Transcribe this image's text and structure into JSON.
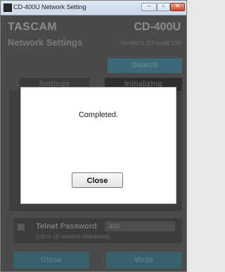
{
  "window": {
    "title": "CD-400U Network Setting",
    "controls": {
      "minimize": "–",
      "maximize": "▫",
      "close": "✕"
    }
  },
  "header": {
    "brand": "TASCAM",
    "model": "CD-400U",
    "section_title": "Network Settings",
    "version": "version:1.0.0 build:130"
  },
  "toolbar": {
    "search_label": "Search"
  },
  "tabs": [
    {
      "label": "Settings"
    },
    {
      "label": "Initializing"
    }
  ],
  "telnet": {
    "label": "Telnet Password",
    "value": "400",
    "hint": "(Up to 10 numeric characters)",
    "checked": false
  },
  "footer": {
    "close_label": "Close",
    "write_label": "Write"
  },
  "dialog": {
    "message": "Completed.",
    "close_label": "Close"
  },
  "colors": {
    "background": "#4a4a4a",
    "accent": "#3c6a78",
    "dialog": "#ffffff"
  }
}
